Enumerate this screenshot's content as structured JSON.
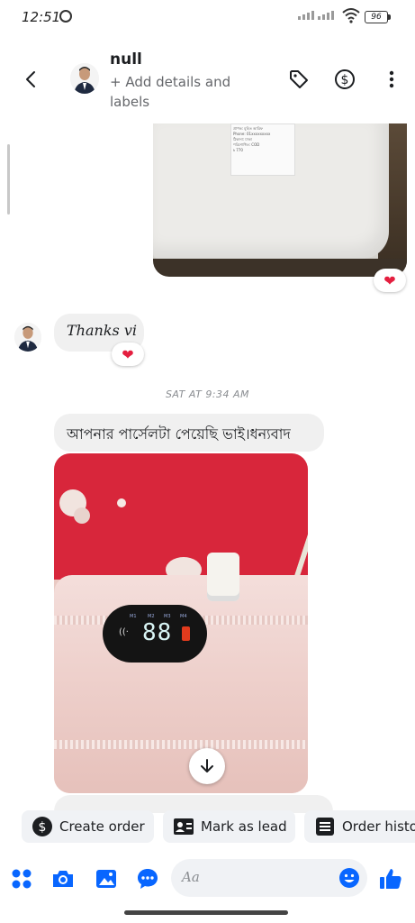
{
  "status_bar": {
    "time": "12:51",
    "battery": "96",
    "icons": [
      "whatsapp-icon",
      "signal-icon",
      "signal-icon",
      "wifi-icon",
      "battery-icon"
    ]
  },
  "header": {
    "contact_name": "null",
    "subtitle": "+ Add details and labels",
    "icons": [
      "back-icon",
      "avatar",
      "tag-icon",
      "dollar-icon",
      "more-vertical-icon"
    ]
  },
  "messages": {
    "parcel_image": {
      "label_lines": [
        "প্রাপক: মুহিত আরিফ",
        "Phone: 01xxxxxxxxx",
        "ঠিকানা: ঢাকা",
        "পরিশোধিত: COD",
        "৳ 770"
      ],
      "reaction": "❤"
    },
    "thanks": {
      "text": "Thanks vi",
      "reaction": "❤"
    },
    "timestamp": "SAT AT 9:34 AM",
    "bengali_message": "আপনার পার্সেলটা পেয়েছি ভাই।ধন্যবাদ",
    "device_photo": {
      "display_value": "88",
      "modes": [
        "M1",
        "M2",
        "M3",
        "M4"
      ]
    }
  },
  "quick_actions": [
    {
      "label": "Create order",
      "icon": "dollar-circle-icon"
    },
    {
      "label": "Mark as lead",
      "icon": "contact-card-icon"
    },
    {
      "label": "Order history",
      "icon": "list-icon"
    }
  ],
  "composer": {
    "placeholder": "Aa",
    "icons": [
      "apps-icon",
      "camera-icon",
      "gallery-icon",
      "chat-bubble-icon",
      "emoji-icon",
      "like-icon"
    ]
  },
  "colors": {
    "accent": "#0866ff",
    "bubble_gray": "#f0f0f0",
    "heart": "#e41e3f"
  }
}
